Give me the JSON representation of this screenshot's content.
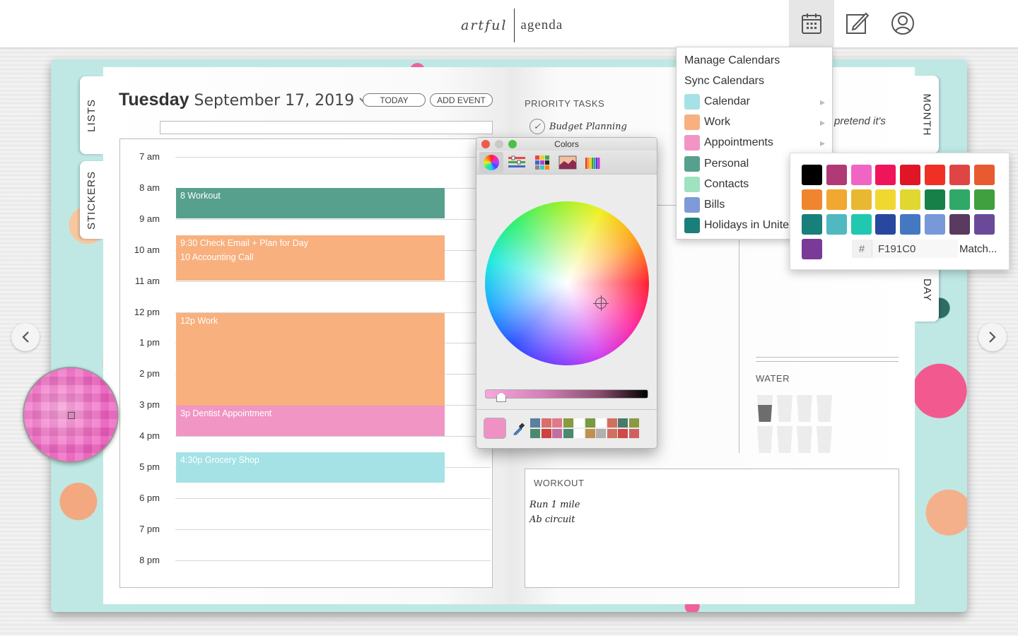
{
  "brand": {
    "left": "artful",
    "right": "agenda"
  },
  "header_icons": [
    {
      "name": "calendar-icon",
      "active": true
    },
    {
      "name": "edit-icon",
      "active": false
    },
    {
      "name": "account-icon",
      "active": false
    }
  ],
  "tabs": {
    "lists": "LISTS",
    "stickers": "STICKERS",
    "month": "MONTH",
    "day": "DAY"
  },
  "date": {
    "weekday": "Tuesday",
    "rest": "September 17, 2019"
  },
  "buttons": {
    "today": "TODAY",
    "add_event": "ADD EVENT"
  },
  "hours": [
    "7 am",
    "8 am",
    "9 am",
    "10 am",
    "11 am",
    "12 pm",
    "1 pm",
    "2 pm",
    "3 pm",
    "4 pm",
    "5 pm",
    "6 pm",
    "7 pm",
    "8 pm"
  ],
  "events": [
    {
      "label": "8 Workout",
      "color": "#57a08e"
    },
    {
      "label": "9:30 Check Email + Plan for Day",
      "color": "#f8b07e"
    },
    {
      "label": "10 Accounting Call",
      "color": "#f8b07e"
    },
    {
      "label": "12p Work",
      "color": "#f8b07e"
    },
    {
      "label": "3p Dentist Appointment",
      "color": "#f095c4"
    },
    {
      "label": "4:30p Grocery Shop",
      "color": "#a4e2e6"
    }
  ],
  "priority": {
    "title": "PRIORITY TASKS",
    "tasks": [
      {
        "label": "Budget Planning",
        "done": true
      }
    ]
  },
  "note_text": "pretend it's",
  "water": {
    "title": "WATER",
    "cups": 8,
    "filled": 1
  },
  "workout": {
    "title": "WORKOUT",
    "lines": [
      "Run 1 mile",
      "Ab circuit"
    ]
  },
  "colors_panel": {
    "title": "Colors",
    "current_color": "#f091c5",
    "tools": [
      "color-wheel-icon",
      "sliders-icon",
      "palettes-icon",
      "image-palette-icon",
      "pencils-icon"
    ],
    "mini_swatches": [
      "#5a7fa0",
      "#d8706a",
      "#e07a8a",
      "#8a9a40",
      "#ffffff",
      "#7a9a40",
      "#ffffff",
      "#d07060",
      "#4a7a6a",
      "#8a9a40",
      "#4a8a70",
      "#d04040",
      "#c070a0",
      "#4a8a70",
      "#ffffff",
      "#c09050",
      "#b0b0b0",
      "#d07060",
      "#d04848",
      "#d06060"
    ]
  },
  "calendar_menu": {
    "items": [
      "Manage Calendars",
      "Sync Calendars"
    ],
    "calendars": [
      {
        "label": "Calendar",
        "color": "#a4e2e6",
        "submenu": true
      },
      {
        "label": "Work",
        "color": "#f8b07e",
        "submenu": true
      },
      {
        "label": "Appointments",
        "color": "#f095c4",
        "submenu": true
      },
      {
        "label": "Personal",
        "color": "#57a08e",
        "submenu": false
      },
      {
        "label": "Contacts",
        "color": "#9ee2c0",
        "submenu": false
      },
      {
        "label": "Bills",
        "color": "#7f9ad8",
        "submenu": false
      },
      {
        "label": "Holidays in Unite",
        "color": "#1a7f7a",
        "submenu": false
      }
    ]
  },
  "palette": {
    "swatches": [
      "#000000",
      "#b03a76",
      "#f065c4",
      "#f0155a",
      "#e01525",
      "#f03025",
      "#e04545",
      "#e85a30",
      "#f08530",
      "#f0a830",
      "#e8b830",
      "#f0d830",
      "#e0d830",
      "#168048",
      "#30a868",
      "#40a040",
      "#17807a",
      "#50b8c0",
      "#20c8b0",
      "#2848a0",
      "#4478c0",
      "#7898d8",
      "#5a3a60",
      "#6a4a98",
      "#7a3a98"
    ],
    "hex_symbol": "#",
    "hex_value": "F191C0",
    "match_label": "Match..."
  }
}
